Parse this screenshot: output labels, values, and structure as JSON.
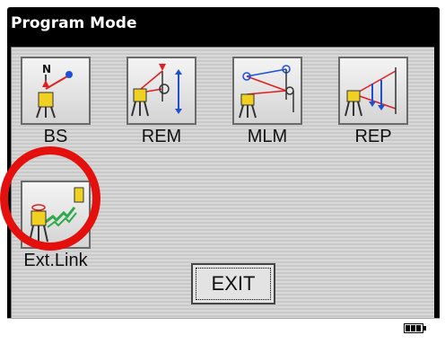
{
  "window": {
    "title": "Program Mode"
  },
  "programs": [
    {
      "label": "BS"
    },
    {
      "label": "REM"
    },
    {
      "label": "MLM"
    },
    {
      "label": "REP"
    },
    {
      "label": "Ext.Link"
    }
  ],
  "exit_label": "EXIT",
  "status": {
    "battery_icon": "battery-full-icon"
  },
  "colors": {
    "title_bar": "#000000",
    "highlight_ring": "#e3100d",
    "accent_blue": "#1e4fd8",
    "accent_red": "#e02020",
    "link_green": "#2ea84a",
    "instrument_yellow": "#f0d020"
  }
}
